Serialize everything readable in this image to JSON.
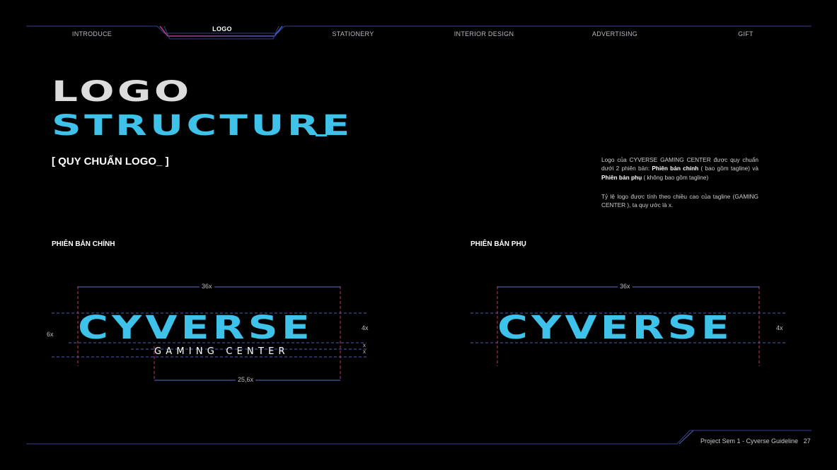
{
  "nav": {
    "items": [
      {
        "label": "INTRODUCE"
      },
      {
        "label": "LOGO"
      },
      {
        "label": "STATIONERY"
      },
      {
        "label": "INTERIOR DESIGN"
      },
      {
        "label": "ADVERTISING"
      },
      {
        "label": "GIFT"
      }
    ],
    "active_index": 1
  },
  "page": {
    "title_line1": "LOGO",
    "title_line2": "STRUCTURE",
    "subtitle": "[ QUY CHUẨN LOGO_ ]"
  },
  "description": {
    "p1_a": "Logo của CYVERSE GAMING CENTER được quy chuẩn dưới 2 phiên bản: ",
    "p1_b": "Phiên bản chính",
    "p1_c": " ( bao gồm tagline) và ",
    "p1_d": "Phiên bản phụ",
    "p1_e": " ( không bao gồm tagline)",
    "p2": "Tỷ lệ logo được tính theo chiều cao của tagline (GAMING CENTER ), ta quy ước là x."
  },
  "primary": {
    "label": "PHIÊN BẢN CHÍNH",
    "wordmark": "CYVERSE",
    "tagline": "GAMING CENTER",
    "dim_width": "36x",
    "dim_total_height": "6x",
    "dim_word_height": "4x",
    "dim_x1": "x",
    "dim_x2": "x",
    "dim_tagline_width": "25,6x"
  },
  "secondary": {
    "label": "PHIÊN BẢN PHỤ",
    "wordmark": "CYVERSE",
    "dim_width": "36x",
    "dim_word_height": "4x"
  },
  "footer": {
    "text": "Project Sem 1 - Cyverse Guideline",
    "page_number": "27"
  },
  "colors": {
    "accent": "#3ec2ea",
    "guide_blue": "#4a5fb8",
    "guide_red": "#c8365a",
    "frame_line": "#3a3f8c"
  }
}
